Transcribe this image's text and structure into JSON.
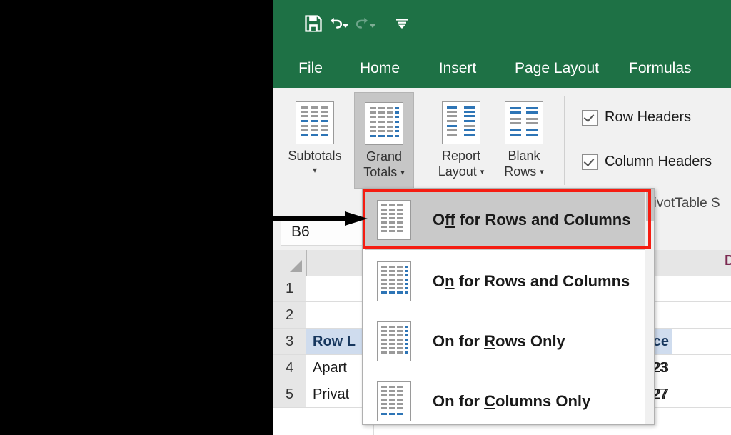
{
  "app": {
    "accent_green": "#1e7145",
    "highlight_red": "#f51c11"
  },
  "quick_access": {
    "items": [
      {
        "name": "save",
        "glyph": "save-icon"
      },
      {
        "name": "undo",
        "glyph": "undo-icon"
      },
      {
        "name": "redo",
        "glyph": "redo-icon"
      },
      {
        "name": "customize",
        "glyph": "customize-quick-access-icon"
      }
    ]
  },
  "ribbon_tabs": [
    {
      "label": "File",
      "active": false
    },
    {
      "label": "Home",
      "active": false
    },
    {
      "label": "Insert",
      "active": false
    },
    {
      "label": "Page Layout",
      "active": false
    },
    {
      "label": "Formulas",
      "active": false
    }
  ],
  "ribbon": {
    "buttons": [
      {
        "label_line1": "Subtotals",
        "label_line2": "",
        "has_dropdown": true,
        "selected": false
      },
      {
        "label_line1": "Grand",
        "label_line2": "Totals",
        "has_dropdown": true,
        "selected": true
      },
      {
        "label_line1": "Report",
        "label_line2": "Layout",
        "has_dropdown": true,
        "selected": false
      },
      {
        "label_line1": "Blank",
        "label_line2": "Rows",
        "has_dropdown": true,
        "selected": false
      }
    ],
    "checkboxes": [
      {
        "label": "Row Headers",
        "checked": true
      },
      {
        "label": "Column Headers",
        "checked": true
      }
    ],
    "group_caption": "PivotTable S"
  },
  "menu": {
    "items": [
      {
        "pre": "O",
        "accel": "ff",
        "post": " for Rows and Columns",
        "full": "Off for Rows and Columns",
        "highlighted": true
      },
      {
        "pre": "O",
        "accel": "n",
        "post": " for Rows and Columns",
        "full": "On for Rows and Columns",
        "highlighted": false
      },
      {
        "pre": "On for ",
        "accel": "R",
        "post": "ows Only",
        "full": "On for Rows Only",
        "highlighted": false
      },
      {
        "pre": "On for ",
        "accel": "C",
        "post": "olumns Only",
        "full": "On for Columns Only",
        "highlighted": false
      }
    ]
  },
  "formula_bar": {
    "name_box_value": "B6"
  },
  "grid": {
    "column_letters": [
      "D"
    ],
    "rows": [
      {
        "num": "1",
        "b_cell": "",
        "far_cell": ""
      },
      {
        "num": "2",
        "b_cell": "",
        "far_cell": ""
      },
      {
        "num": "3",
        "b_cell": "Row L",
        "far_cell": "ce",
        "header": true
      },
      {
        "num": "4",
        "b_cell": "Apart",
        "far_cell": "23",
        "header": false
      },
      {
        "num": "5",
        "b_cell": "Privat",
        "far_cell": "27",
        "header": false
      }
    ]
  }
}
